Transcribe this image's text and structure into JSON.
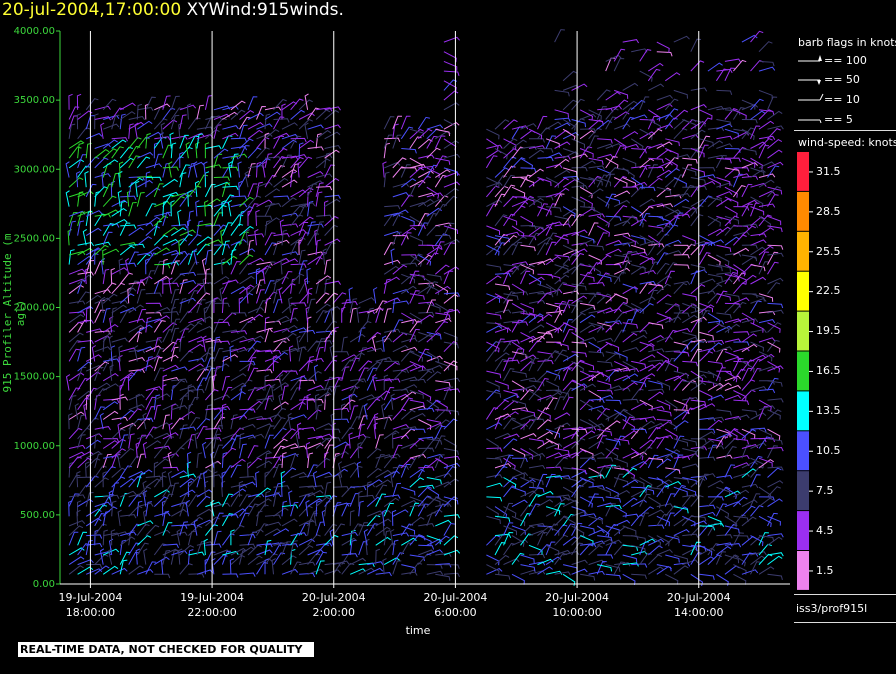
{
  "header": {
    "timestamp": "20-jul-2004,17:00:00",
    "title": "XYWind:915winds."
  },
  "banner": "REAL-TIME DATA, NOT CHECKED FOR QUALITY",
  "legend": {
    "barb_title": "barb flags in knots",
    "barb_entries": [
      "== 100",
      "== 50",
      "== 10",
      "== 5"
    ],
    "speed_title": "wind-speed: knots",
    "speed_levels": [
      "31.5",
      "28.5",
      "25.5",
      "22.5",
      "19.5",
      "16.5",
      "13.5",
      "10.5",
      "7.5",
      "4.5",
      "1.5"
    ],
    "speed_colors": [
      "#ff1f3c",
      "#ff8a00",
      "#ffb300",
      "#ffff00",
      "#b8f53a",
      "#2bd82b",
      "#00ffff",
      "#4b50ff",
      "#3c3c6e",
      "#9b2ff0",
      "#ee82ee"
    ],
    "source": "iss3/prof915l"
  },
  "chart_data": {
    "type": "scatter",
    "title": "XYWind:915winds.",
    "xlabel": "time",
    "ylabel": "915 Profiler Altitude (m agl)",
    "ylim": [
      0,
      4000
    ],
    "y_ticks": [
      "0.00",
      "500.00",
      "1000.00",
      "1500.00",
      "2000.00",
      "2500.00",
      "3000.00",
      "3500.00",
      "4000.00"
    ],
    "x_ticks": [
      {
        "date": "19-Jul-2004",
        "time": "18:00:00"
      },
      {
        "date": "19-Jul-2004",
        "time": "22:00:00"
      },
      {
        "date": "20-Jul-2004",
        "time": "2:00:00"
      },
      {
        "date": "20-Jul-2004",
        "time": "6:00:00"
      },
      {
        "date": "20-Jul-2004",
        "time": "10:00:00"
      },
      {
        "date": "20-Jul-2004",
        "time": "14:00:00"
      }
    ],
    "xlim_hours": [
      -1,
      23
    ],
    "grid_x": true,
    "series_note": "wind barbs colored by speed"
  }
}
